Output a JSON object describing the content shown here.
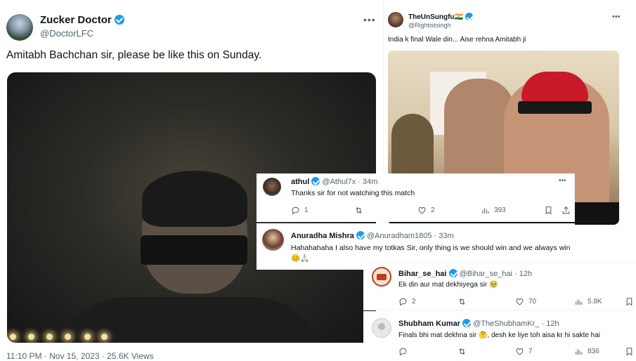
{
  "main_tweet": {
    "display_name": "Zucker Doctor",
    "handle": "@DoctorLFC",
    "more": "•••",
    "text": "Amitabh Bachchan sir, please be like this on Sunday.",
    "timestamp": "11:10 PM · Nov 15, 2023 · 25.6K Views"
  },
  "top_right_tweet": {
    "display_name": "TheUnSungfu🇮🇳",
    "handle": "@Rightistsingh",
    "more": "•••",
    "text": "India k final Wale din... Aise rehna Amitabh ji"
  },
  "replies": [
    {
      "display_name": "athul",
      "handle": "@Athul7x",
      "time": "· 34m",
      "text": "Thanks sir for not watching this match",
      "replies": "1",
      "reposts": "",
      "likes": "2",
      "views": "393"
    },
    {
      "display_name": "Anuradha Mishra",
      "handle": "@Anuradham1805",
      "time": "· 33m",
      "text": "Hahahahaha I also have my totkas  Sir, only thing is we should win and we always win 😊🙏🏻"
    },
    {
      "display_name": "Bihar_se_hai",
      "handle": "@Bihar_se_hai",
      "time": "· 12h",
      "text": "Ek din aur mat dekhiyega sir 🥹",
      "replies": "2",
      "reposts": "",
      "likes": "70",
      "views": "5.8K"
    },
    {
      "display_name": "Shubham Kumar",
      "handle": "@TheShubhamKr_",
      "time": "· 12h",
      "text": "Finals bhi mat dekhna sir 🤔, desh ke liye toh aisa kr hi sakte hai",
      "replies": "",
      "reposts": "",
      "likes": "7",
      "views": "836"
    }
  ],
  "icons": {
    "reply": "reply-icon",
    "repost": "repost-icon",
    "like": "like-icon",
    "views": "views-icon",
    "bookmark": "bookmark-icon",
    "share": "share-icon",
    "verified": "verified-badge-icon"
  },
  "colors": {
    "verified": "#1d9bf0",
    "secondary_text": "#536471"
  }
}
